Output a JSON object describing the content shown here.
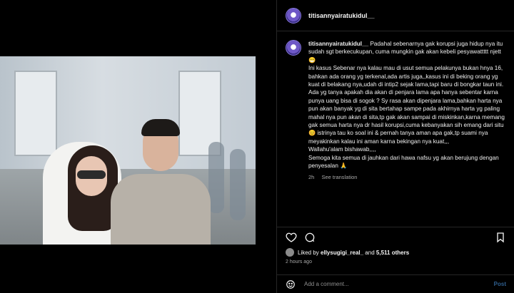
{
  "post": {
    "username": "titisannyairatukidul__"
  },
  "caption": {
    "username": "titisannyairatukidul__",
    "paragraphs": [
      "Padahal sebenarnya gak korupsi juga hidup nya itu sudah sgt berkecukupan, cuma mungkin gak akan kebeli pesyawattttt njett 😁",
      "Ini kasus Sebenar nya kalau mau di usut semua pelakunya bukan hnya 16, bahkan ada orang yg terkenal,ada artis juga,,kasus ini di beking orang yg kuat di belakang nya,udah di intip2 sejak lama,tapi baru di bongkar taun ini.",
      "Ada yg tanya apakah dia akan di penjara lama apa hanya sebentar karna punya uang bisa di sogok ? Sy rasa akan dipenjara lama,bahkan harta nya pun akan banyak yg di sita bertahap sampe pada akhirnya harta yg paling mahal nya pun akan di sita,tp gak akan sampai di miskinkan,karna memang gak semua harta nya dr hasil korupsi,cuma kebanyakan sih emang dari situ 😊 istrinya tau ko soal ini & pernah tanya aman apa gak,tp suami nya meyakinkan kalau ini aman karna bekingan nya kuat,,,",
      "Wallahu'alam bishawab,,,,",
      "Semoga kita semua di jauhkan dari hawa nafsu yg akan berujung dengan penyesalan 🙏"
    ],
    "time_ago": "2h",
    "see_translation": "See translation"
  },
  "engagement": {
    "liked_by_prefix": "Liked by",
    "liked_by_user": "ellysugigi_real_",
    "and_text": "and",
    "others": "5,511 others",
    "posted_ago": "2 hours ago"
  },
  "comment": {
    "placeholder": "Add a comment...",
    "post_label": "Post"
  },
  "icons": {
    "like": "heart-icon",
    "comment": "comment-icon",
    "save": "bookmark-icon",
    "emoji": "emoji-icon"
  }
}
